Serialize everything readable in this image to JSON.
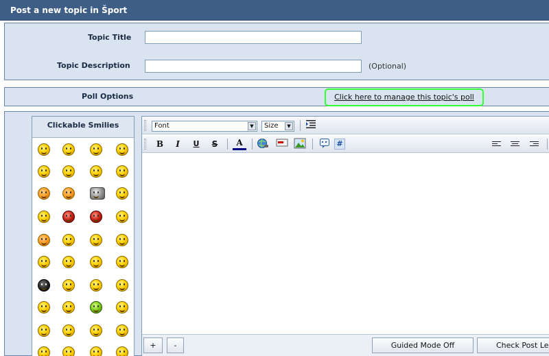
{
  "header": {
    "title": "Post a new topic in Šport"
  },
  "topic": {
    "title_label": "Topic Title",
    "title_value": "",
    "description_label": "Topic Description",
    "description_value": "",
    "optional_note": "(Optional)"
  },
  "poll": {
    "label": "Poll Options",
    "link_text": "Click here to manage this topic's poll",
    "highlight_color": "#33ff33"
  },
  "smilies": {
    "heading": "Clickable Smilies",
    "icons": [
      "smile-icon",
      "grin-icon",
      "happy-icon",
      "wink-icon",
      "laugh-icon",
      "tongue-icon",
      "angry-icon",
      "glasses-icon",
      "blush-icon",
      "cheeky-icon",
      "wolf-icon",
      "sly-icon",
      "sad-icon",
      "devil-icon",
      "evil-icon",
      "confused-icon",
      "alert-icon",
      "flower-icon",
      "smirk-icon",
      "hmm-icon",
      "angel-icon",
      "kiss-icon",
      "biggrin-icon",
      "neutral-icon",
      "ninja-icon",
      "shocked-icon",
      "thinking-icon",
      "dead-icon",
      "wide-eyes-icon",
      "nerd-icon",
      "sick-icon",
      "shades-icon",
      "cry-icon",
      "thumbsup-icon",
      "wave-icon",
      "worried-icon",
      "surprised-icon",
      "rolleyes-icon",
      "singing-icon",
      "ok-icon"
    ]
  },
  "editor": {
    "font_select": "Font",
    "size_select": "Size",
    "bold_label": "B",
    "italic_label": "I",
    "underline_label": "U",
    "strike_label": "S",
    "color_label": "A",
    "hash_label": "#",
    "body_text": "",
    "accent_color": "#3f5e86"
  },
  "bottom": {
    "add_label": "+",
    "remove_label": "-",
    "guided_mode_label": "Guided Mode Off",
    "check_length_label": "Check Post Le"
  }
}
